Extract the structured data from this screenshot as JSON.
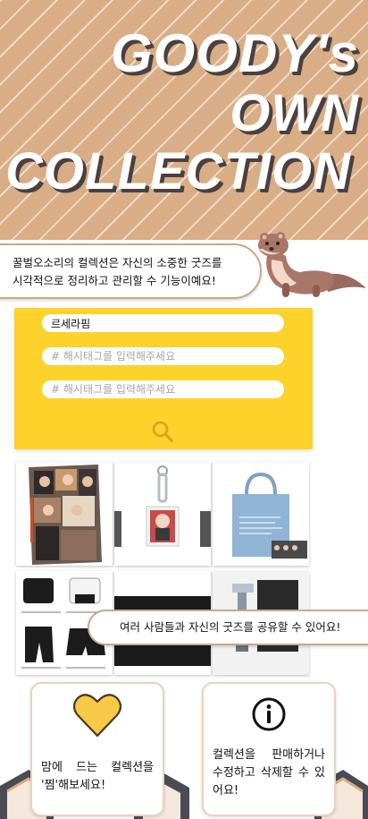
{
  "hero": {
    "line1": "GOODY's",
    "line2": "OWN",
    "line3": "COLLECTION"
  },
  "intro": {
    "line1": "꿀벌오소리의 컬렉션은 자신의 소중한 굿즈를",
    "line2": "시각적으로 정리하고 관리할 수 기능이예요!"
  },
  "search": {
    "name_value": "르세라핌",
    "tag1_placeholder": "# 해시태그를 입력해주세요",
    "tag2_placeholder": "# 해시태그를 입력해주세요",
    "icon": "search-icon"
  },
  "gallery": {
    "items": [
      "photobook",
      "keyring",
      "tote-bag",
      "outfit-set",
      "slogan",
      "lightstick"
    ]
  },
  "share": {
    "text": "여러 사람들과 자신의 굿즈를 공유할 수 있어요!"
  },
  "features": {
    "like": {
      "icon": "heart-icon",
      "text": "맘에 드는 컬렉션을 '찜'해보세요!"
    },
    "info": {
      "icon": "info-icon",
      "text": "컬렉션을 판매하거나 수정하고 삭제할 수 있어요!"
    }
  },
  "colors": {
    "hero_bg": "#d9ad85",
    "panel_yellow": "#fdd22a",
    "bubble_border": "#c9a888",
    "heart": "#f7c948"
  }
}
